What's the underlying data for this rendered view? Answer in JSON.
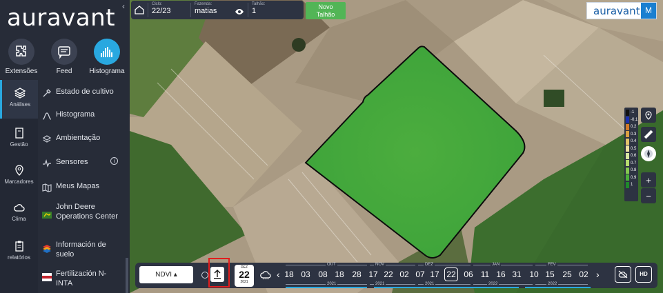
{
  "sidebar": {
    "brand": "auravant",
    "top_tools": [
      {
        "label": "Extensões",
        "icon": "puzzle-icon"
      },
      {
        "label": "Feed",
        "icon": "feed-icon"
      },
      {
        "label": "Histograma",
        "icon": "histogram-icon",
        "active": true
      }
    ],
    "nav": [
      {
        "label": "Análises",
        "icon": "layers-icon",
        "active": true
      },
      {
        "label": "Gestão",
        "icon": "notebook-icon"
      },
      {
        "label": "Marcadores",
        "icon": "map-pin-icon"
      },
      {
        "label": "Clima",
        "icon": "cloud-icon"
      },
      {
        "label": "relatórios",
        "icon": "clipboard-icon"
      }
    ],
    "sub_items": [
      {
        "label": "Estado de cultivo",
        "icon": "tools-icon"
      },
      {
        "label": "Histograma",
        "icon": "curve-icon"
      },
      {
        "label": "Ambientação",
        "icon": "layers-icon"
      },
      {
        "label": "Sensores",
        "icon": "pulse-icon"
      },
      {
        "label": "Meus Mapas",
        "icon": "folded-map-icon"
      },
      {
        "label": "John Deere Operations Center",
        "icon": "john-deere-icon"
      },
      {
        "label": "Información de suelo",
        "icon": "soil-stack-icon"
      },
      {
        "label": "Fertilización N-INTA",
        "icon": "inta-icon"
      }
    ]
  },
  "topbar": {
    "cycle_caption": "Ciclo:",
    "cycle_value": "22/23",
    "farm_caption": "Fazenda:",
    "farm_value": "matias",
    "field_caption": "Talhão:",
    "field_value": "1",
    "new_field_line1": "Novo",
    "new_field_line2": "Talhão"
  },
  "brand_badge": {
    "text": "auravant",
    "user_initial": "M"
  },
  "legend": [
    {
      "label": "-1",
      "color": "#111111"
    },
    {
      "label": "-0.1",
      "color": "#1a2fb0"
    },
    {
      "label": "0.2",
      "color": "#d07a2a"
    },
    {
      "label": "0.3",
      "color": "#d9a040"
    },
    {
      "label": "0.4",
      "color": "#e2c46a"
    },
    {
      "label": "0.5",
      "color": "#eee2a0"
    },
    {
      "label": "0.6",
      "color": "#d8e8a0"
    },
    {
      "label": "0.7",
      "color": "#b6dc6e"
    },
    {
      "label": "0.8",
      "color": "#86c850"
    },
    {
      "label": "0.9",
      "color": "#4caf3a"
    },
    {
      "label": "1",
      "color": "#1f8a2a"
    }
  ],
  "map_tools": {
    "zoom_in": "+",
    "zoom_out": "−"
  },
  "bottombar": {
    "index_select": "NDVI ▴",
    "date_month": "DEZ",
    "date_day": "22",
    "date_year": "2021",
    "prev_arrow": "‹",
    "next_arrow": "›",
    "days": [
      "18",
      "03",
      "08",
      "18",
      "28",
      "17",
      "22",
      "02",
      "07",
      "17",
      "22",
      "06",
      "11",
      "16",
      "31",
      "10",
      "15",
      "25",
      "02"
    ],
    "selected_day_index": 10,
    "months": [
      "OUT",
      "NOV",
      "DEZ",
      "JAN",
      "FEV"
    ],
    "years": [
      "2021",
      "2021",
      "2021",
      "2022",
      "2022"
    ],
    "hd_label": "HD"
  }
}
